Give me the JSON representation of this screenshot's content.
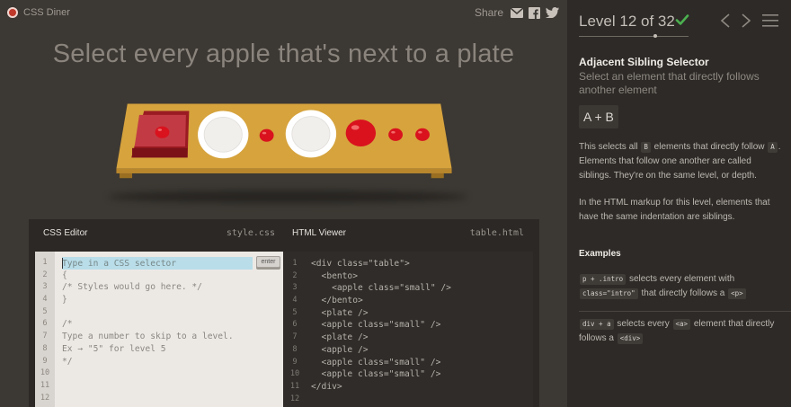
{
  "app": {
    "title": "CSS Diner"
  },
  "share": {
    "label": "Share",
    "icons": [
      "mail-icon",
      "facebook-icon",
      "twitter-icon"
    ]
  },
  "instruction": "Select every apple that's next to a plate",
  "table": {
    "items": [
      "bento-with-small-apple",
      "plate",
      "small-apple",
      "plate",
      "apple",
      "small-apple",
      "small-apple"
    ]
  },
  "css_editor": {
    "title": "CSS Editor",
    "filename": "style.css",
    "input_placeholder": "Type in a CSS selector",
    "input_value": "",
    "enter_label": "enter",
    "line_numbers": [
      "1",
      "2",
      "3",
      "4",
      "5",
      "6",
      "7",
      "8",
      "9",
      "10",
      "11",
      "12"
    ],
    "lines": [
      "",
      "{",
      "/* Styles would go here. */",
      "}",
      "",
      "/*",
      "Type a number to skip to a level.",
      "Ex → \"5\" for level 5",
      "*/",
      "",
      "",
      ""
    ]
  },
  "html_viewer": {
    "title": "HTML Viewer",
    "filename": "table.html",
    "line_numbers": [
      "1",
      "2",
      "3",
      "4",
      "5",
      "6",
      "7",
      "8",
      "9",
      "10",
      "11",
      "12"
    ],
    "lines": [
      "<div class=\"table\">",
      "  <bento>",
      "    <apple class=\"small\" />",
      "  </bento>",
      "  <plate />",
      "  <apple class=\"small\" />",
      "  <plate />",
      "  <apple />",
      "  <apple class=\"small\" />",
      "  <apple class=\"small\" />",
      "</div>",
      ""
    ]
  },
  "sidebar": {
    "level_title": "Level 12 of 32",
    "level_current": 12,
    "level_total": 32,
    "selector_name": "Adjacent Sibling Selector",
    "selector_desc": "Select an element that directly follows another element",
    "syntax": "A + B",
    "desc1": {
      "p1": "This selects all",
      "tok1": "B",
      "p2": "elements that directly follow",
      "tok2": "A",
      "p3": ". Elements that follow one another are called siblings. They're on the same level, or depth."
    },
    "desc2": "In the HTML markup for this level, elements that have the same indentation are siblings.",
    "examples_title": "Examples",
    "examples": [
      {
        "code": "p + .intro",
        "t1": "selects every element with",
        "code2": "class=\"intro\"",
        "t2": "that directly follows a",
        "code3": "<p>"
      },
      {
        "code": "div + a",
        "t1": "selects every",
        "code2": "<a>",
        "t2": "element that directly follows a",
        "code3": "<div>"
      }
    ]
  },
  "colors": {
    "accent_check": "#4cb050",
    "table": "#d6a33d",
    "apple": "#d9121e",
    "plate": "#ffffff",
    "bento": "#9b1b22"
  }
}
